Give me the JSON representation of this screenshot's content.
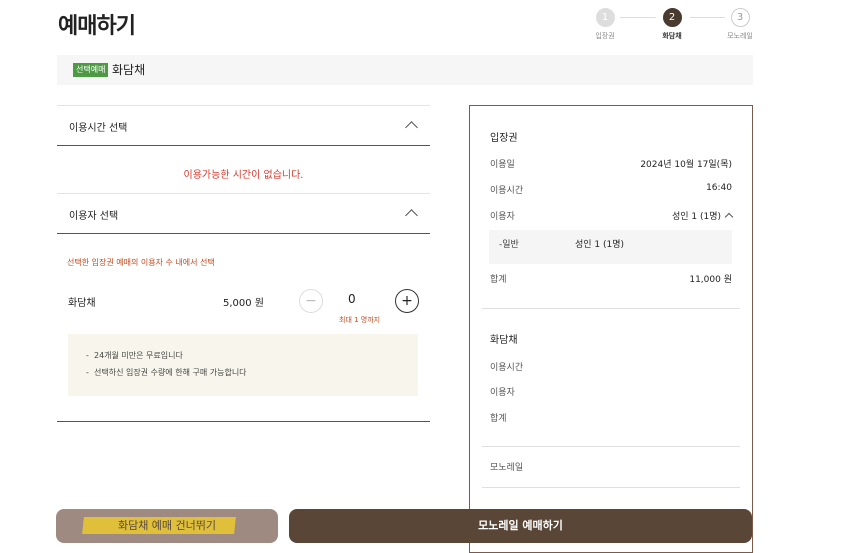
{
  "page_title": "예매하기",
  "steps": [
    {
      "num": "1",
      "label": "입장권"
    },
    {
      "num": "2",
      "label": "화담채"
    },
    {
      "num": "3",
      "label": "모노레일"
    }
  ],
  "selected": {
    "badge": "선택예매",
    "name": "화담채"
  },
  "time_section": {
    "title": "이용시간 선택",
    "empty_message": "이용가능한 시간이 없습니다."
  },
  "user_section": {
    "title": "이용자 선택",
    "note": "선택한 입장권 예매의 이용자 수 내에서 선택",
    "item_name": "화담채",
    "price": "5,000 원",
    "minus": "−",
    "plus": "+",
    "quantity": "0",
    "max": "최대 1 명까지",
    "info": [
      "24개월 미만은 무료입니다",
      "선택하신 입장권 수량에 한해 구매 가능합니다"
    ]
  },
  "summary": {
    "ticket": {
      "title": "입장권",
      "date_label": "이용일",
      "date_value": "2024년 10월 17일(목)",
      "time_label": "이용시간",
      "time_value": "16:40",
      "user_label": "이용자",
      "user_value": "성인 1 (1명)",
      "sub_label": "-일반",
      "sub_value": "성인 1 (1명)",
      "total_label": "합계",
      "total_value": "11,000 원"
    },
    "hwadam": {
      "title": "화담채",
      "time_label": "이용시간",
      "user_label": "이용자",
      "total_label": "합계"
    },
    "monorail": {
      "title": "모노레일"
    }
  },
  "buttons": {
    "skip": "화담채 예매 건너뛰기",
    "monorail": "모노레일 예매하기"
  },
  "colors": {
    "accent": "#5a4637",
    "skip_button": "#9e8a80",
    "highlight": "#e0c03a",
    "badge": "#4e9a44",
    "warning": "#d63b2f"
  }
}
